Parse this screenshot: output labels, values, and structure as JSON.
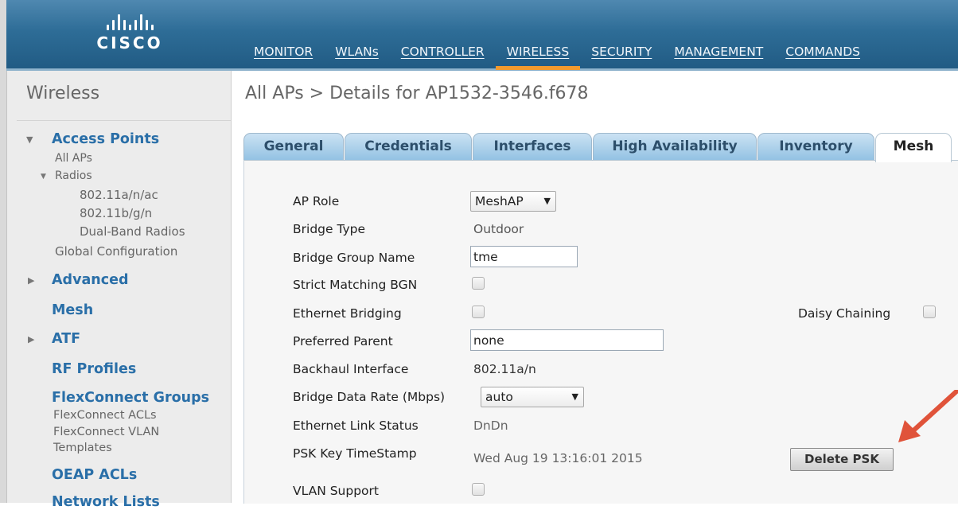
{
  "brand": {
    "logo_text": "CISCO"
  },
  "nav": {
    "items": [
      {
        "label": "MONITOR"
      },
      {
        "label": "WLANs"
      },
      {
        "label": "CONTROLLER"
      },
      {
        "label": "WIRELESS"
      },
      {
        "label": "SECURITY"
      },
      {
        "label": "MANAGEMENT"
      },
      {
        "label": "COMMANDS"
      }
    ],
    "active": "WIRELESS"
  },
  "sidebar": {
    "title": "Wireless",
    "access_points": "Access Points",
    "all_aps": "All APs",
    "radios": "Radios",
    "radio_a": "802.11a/n/ac",
    "radio_b": "802.11b/g/n",
    "dual_band": "Dual-Band Radios",
    "global_config": "Global Configuration",
    "advanced": "Advanced",
    "mesh": "Mesh",
    "atf": "ATF",
    "rf_profiles": "RF Profiles",
    "flex_groups": "FlexConnect Groups",
    "flex_acls": "FlexConnect ACLs",
    "flex_vlan_1": "FlexConnect VLAN",
    "flex_vlan_2": "Templates",
    "oeap_acls": "OEAP ACLs",
    "network_lists": "Network Lists"
  },
  "main": {
    "breadcrumb": "All APs > Details for AP1532-3546.f678",
    "tabs": [
      {
        "label": "General"
      },
      {
        "label": "Credentials"
      },
      {
        "label": "Interfaces"
      },
      {
        "label": "High Availability"
      },
      {
        "label": "Inventory"
      },
      {
        "label": "Mesh"
      }
    ],
    "active_tab": "Mesh"
  },
  "form": {
    "ap_role": {
      "label": "AP Role",
      "value": "MeshAP"
    },
    "bridge_type": {
      "label": "Bridge Type",
      "value": "Outdoor"
    },
    "bridge_group_name": {
      "label": "Bridge Group Name",
      "value": "tme"
    },
    "strict_matching_bgn": {
      "label": "Strict Matching BGN",
      "checked": false
    },
    "ethernet_bridging": {
      "label": "Ethernet Bridging",
      "checked": false
    },
    "daisy_chaining": {
      "label": "Daisy Chaining",
      "checked": false
    },
    "preferred_parent": {
      "label": "Preferred Parent",
      "value": "none"
    },
    "backhaul_interface": {
      "label": "Backhaul Interface",
      "value": "802.11a/n"
    },
    "bridge_data_rate": {
      "label": "Bridge Data Rate (Mbps)",
      "value": "auto"
    },
    "ethernet_link_status": {
      "label": "Ethernet Link Status",
      "value": "DnDn"
    },
    "psk_key_timestamp": {
      "label": "PSK Key TimeStamp",
      "value": "Wed Aug 19 13:16:01 2015"
    },
    "delete_psk": {
      "label": "Delete PSK"
    },
    "vlan_support": {
      "label": "VLAN Support",
      "checked": false
    }
  },
  "colors": {
    "header": "#2e6d97",
    "active_nav": "#f29a2e",
    "sidebar_link": "#2a6fa8",
    "annotation_arrow": "#e0533a"
  }
}
